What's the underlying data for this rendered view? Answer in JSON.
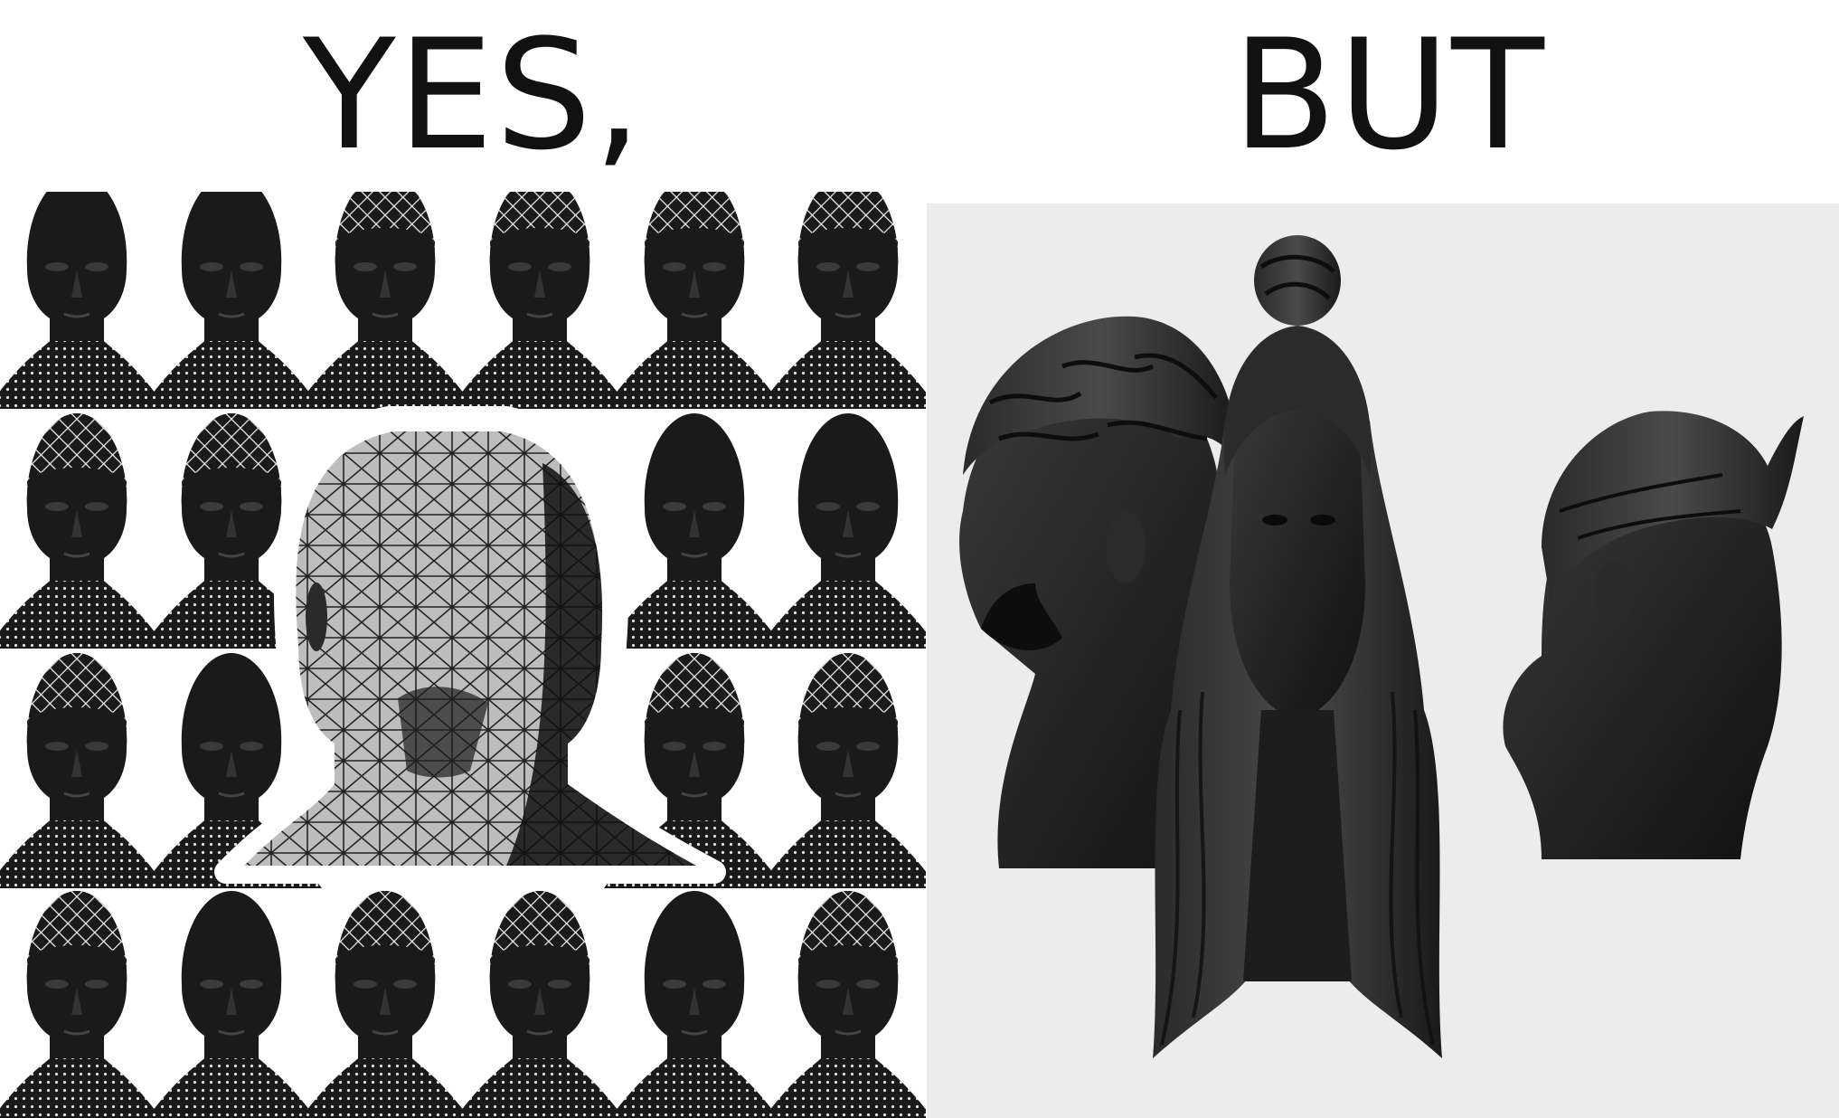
{
  "captions": {
    "left": "YES,",
    "right": "BUT"
  },
  "illustrations": {
    "left_panel": "wireframe-head-grid",
    "right_panel": "hairstyled-head-sculptures"
  },
  "colors": {
    "ink": "#111111",
    "head_dark": "#1a1a1a",
    "mesh_light": "#e8e8e8",
    "right_bg": "#ececec"
  }
}
